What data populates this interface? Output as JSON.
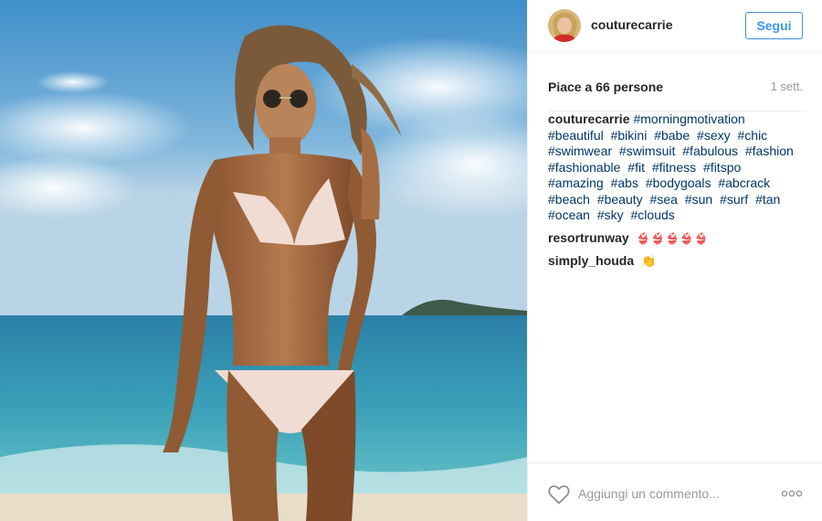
{
  "post": {
    "username": "couturecarrie",
    "follow_label": "Segui",
    "likes_text": "Piace a 66 persone",
    "time_ago": "1 sett."
  },
  "caption": {
    "author": "couturecarrie",
    "hashtags": [
      "#morningmotivation",
      "#beautiful",
      "#bikini",
      "#babe",
      "#sexy",
      "#chic",
      "#swimwear",
      "#swimsuit",
      "#fabulous",
      "#fashion",
      "#fashionable",
      "#fit",
      "#fitness",
      "#fitspo",
      "#amazing",
      "#abs",
      "#bodygoals",
      "#abcrack",
      "#beach",
      "#beauty",
      "#sea",
      "#sun",
      "#surf",
      "#tan",
      "#ocean",
      "#sky",
      "#clouds"
    ]
  },
  "comments": [
    {
      "author": "resortrunway",
      "text": "👙👙👙👙👙",
      "kind": "bikini-emoji"
    },
    {
      "author": "simply_houda",
      "text": "👏",
      "kind": "clap-emoji"
    }
  ],
  "footer": {
    "comment_placeholder": "Aggiungi un commento...",
    "like_icon": "heart-outline-icon",
    "more_icon": "more-options-icon"
  },
  "colors": {
    "accent": "#3897f0",
    "hashtag": "#003569",
    "muted": "#999999",
    "text": "#262626",
    "border": "#efefef"
  }
}
